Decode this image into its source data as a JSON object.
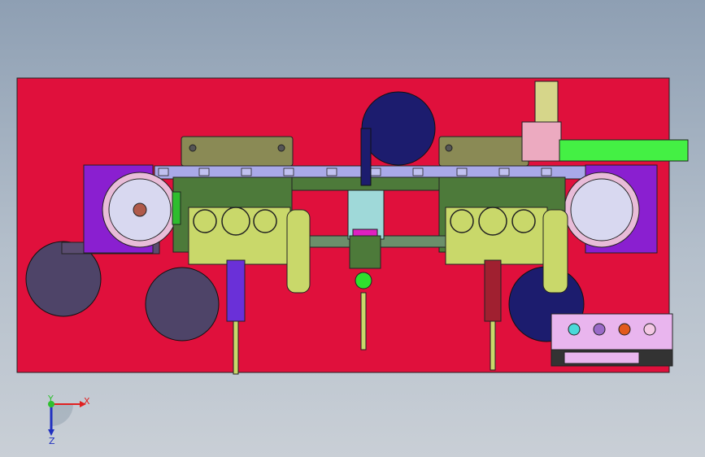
{
  "colors": {
    "background_top": "#8e9fb3",
    "base_plate": "#e0103c",
    "conveyor_rail": "#a9a9e8",
    "frame_olive": "#4d7a3a",
    "bracket_khaki": "#8a8a55",
    "motor_yellow_green": "#c9d86a",
    "wheel_disk": "#d8d8f0",
    "side_purple": "#8a1fd0",
    "navy_disk": "#1c1c6e",
    "grey_purple_disk": "#4e4468",
    "cylinder_green": "#44f044",
    "control_panel": "#e9b5ee"
  },
  "icons": {
    "triad": "xyz-orientation-triad-icon",
    "indicator_cyan": "cyan-indicator-icon",
    "indicator_purple": "purple-indicator-icon",
    "indicator_orange": "orange-indicator-icon",
    "indicator_pink": "pink-indicator-icon"
  },
  "triad": {
    "x_label": "X",
    "y_label": "Y",
    "z_label": "Z"
  }
}
